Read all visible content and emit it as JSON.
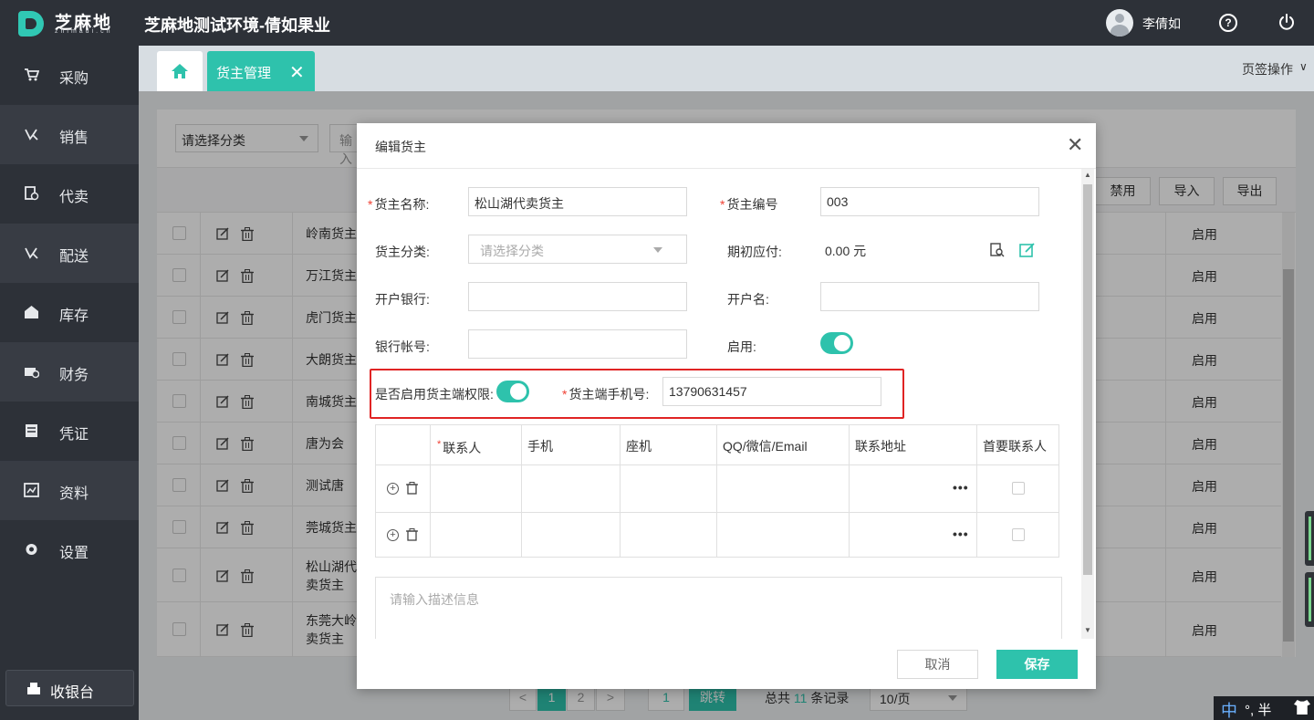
{
  "app": {
    "logo_text": "芝麻地",
    "logo_sub": "zhimadi.cn",
    "title": "芝麻地测试环境-倩如果业",
    "user_name": "李倩如",
    "help_glyph": "?"
  },
  "sidebar": {
    "items": [
      {
        "label": "采购",
        "icon": "cart-icon"
      },
      {
        "label": "销售",
        "icon": "sales-icon"
      },
      {
        "label": "代卖",
        "icon": "consign-icon"
      },
      {
        "label": "配送",
        "icon": "delivery-icon"
      },
      {
        "label": "库存",
        "icon": "warehouse-icon"
      },
      {
        "label": "财务",
        "icon": "finance-icon"
      },
      {
        "label": "凭证",
        "icon": "voucher-icon"
      },
      {
        "label": "资料",
        "icon": "data-icon"
      },
      {
        "label": "设置",
        "icon": "gear-icon"
      }
    ],
    "cashier_label": "收银台"
  },
  "tabs": {
    "active_label": "货主管理",
    "close_glyph": "✕",
    "ops_label": "页签操作",
    "ops_caret": "∨"
  },
  "filters": {
    "category_placeholder": "请选择分类",
    "search_placeholder": "输入"
  },
  "toolbar": {
    "disable_label": "禁用",
    "import_label": "导入",
    "export_label": "导出"
  },
  "table": {
    "rows": [
      {
        "name": "岭南货主",
        "status": "启用"
      },
      {
        "name": "万江货主",
        "status": "启用"
      },
      {
        "name": "虎门货主",
        "status": "启用"
      },
      {
        "name": "大朗货主",
        "status": "启用"
      },
      {
        "name": "南城货主",
        "status": "启用"
      },
      {
        "name": "唐为会",
        "status": "启用"
      },
      {
        "name": "测试唐",
        "status": "启用"
      },
      {
        "name": "莞城货主",
        "status": "启用"
      },
      {
        "name": "松山湖代卖货主",
        "status": "启用"
      },
      {
        "name": "东莞大岭卖货主",
        "status": "启用"
      }
    ]
  },
  "pagination": {
    "prev": "<",
    "next": ">",
    "pages": [
      "1",
      "2"
    ],
    "jump_value": "1",
    "jump_label": "跳转",
    "total_prefix": "总共",
    "total_count": "11",
    "total_suffix": "条记录",
    "page_size": "10/页"
  },
  "dialog": {
    "title": "编辑货主",
    "close_glyph": "✕",
    "owner_name_label": "货主名称:",
    "owner_name_value": "松山湖代卖货主",
    "owner_code_label": "货主编号",
    "owner_code_value": "003",
    "category_label": "货主分类:",
    "category_placeholder": "请选择分类",
    "initial_payable_label": "期初应付:",
    "initial_payable_value": "0.00 元",
    "bank_label": "开户银行:",
    "account_name_label": "开户名:",
    "account_no_label": "银行帐号:",
    "enabled_label": "启用:",
    "enabled": true,
    "portal_perm_label": "是否启用货主端权限:",
    "portal_perm_enabled": true,
    "portal_phone_label": "货主端手机号:",
    "portal_phone_value": "13790631457",
    "contacts": {
      "headers": [
        "联系人",
        "手机",
        "座机",
        "QQ/微信/Email",
        "联系地址",
        "首要联系人"
      ],
      "more_glyph": "•••",
      "row_count": 2
    },
    "description_placeholder": "请输入描述信息",
    "cancel_label": "取消",
    "save_label": "保存"
  },
  "ime": {
    "mode": "中",
    "text": "°, 半"
  },
  "colors": {
    "accent": "#2ec2ac",
    "dark": "#2d3138",
    "required": "#f04134",
    "highlight": "#e02424"
  }
}
